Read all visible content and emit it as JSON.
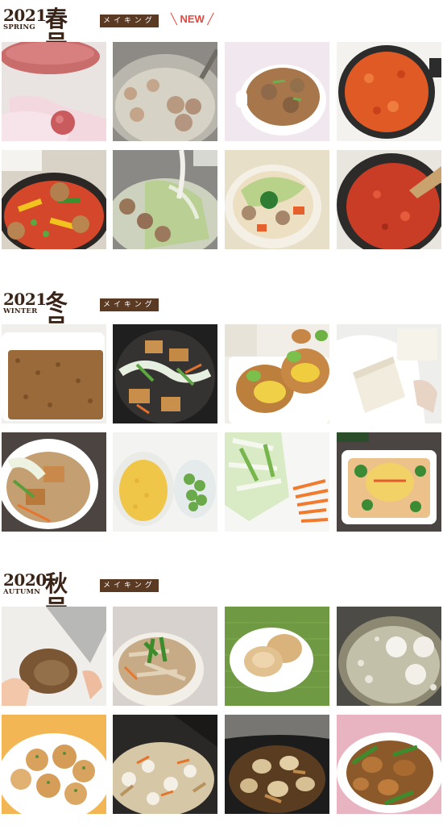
{
  "sections": [
    {
      "year": "2021",
      "season": "SPRING",
      "issue": "春号",
      "making_label": "メイキング",
      "new_label": "NEW",
      "photos": [
        {
          "subject": "minced-meat-meatball-hands"
        },
        {
          "subject": "meatballs-boiling-pot"
        },
        {
          "subject": "meatball-soup-cup"
        },
        {
          "subject": "tomato-sauce-skillet"
        },
        {
          "subject": "meatballs-peppers-skillet"
        },
        {
          "subject": "cabbage-meatballs-milk-pour"
        },
        {
          "subject": "cabbage-cream-stew-bowl"
        },
        {
          "subject": "tomato-sauce-stir"
        }
      ]
    },
    {
      "year": "2021",
      "season": "WINTER",
      "issue": "冬号",
      "making_label": "メイキング",
      "photos": [
        {
          "subject": "soy-mince-tray"
        },
        {
          "subject": "napa-tofu-stirfry"
        },
        {
          "subject": "fried-tofu-pouches-egg-beans"
        },
        {
          "subject": "tofu-draining-paper"
        },
        {
          "subject": "fried-tofu-napa-bowl"
        },
        {
          "subject": "scrambled-egg-green-beans-bowls"
        },
        {
          "subject": "napa-cabbage-carrot-sliced"
        },
        {
          "subject": "tofu-gratin-dish"
        }
      ]
    },
    {
      "year": "2020",
      "season": "AUTUMN",
      "issue": "秋号",
      "making_label": "メイキング",
      "photos": [
        {
          "subject": "taro-peeling-knife"
        },
        {
          "subject": "mushroom-greens-bowl"
        },
        {
          "subject": "taro-patties-plate"
        },
        {
          "subject": "taro-balls-frying-oil"
        },
        {
          "subject": "taro-balls-herbs-plate"
        },
        {
          "subject": "rice-cooker-mixed-vegetables"
        },
        {
          "subject": "simmered-taro-pot"
        },
        {
          "subject": "braised-chicken-taro-beans-plate"
        }
      ]
    }
  ]
}
